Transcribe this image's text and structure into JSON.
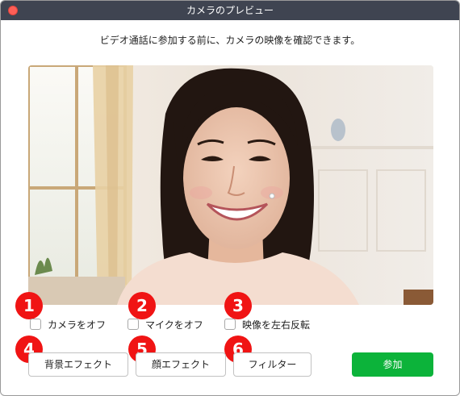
{
  "window": {
    "title": "カメラのプレビュー"
  },
  "instruction": "ビデオ通話に参加する前に、カメラの映像を確認できます。",
  "badges": [
    "1",
    "2",
    "3",
    "4",
    "5",
    "6"
  ],
  "options": {
    "camera_off": "カメラをオフ",
    "mic_off": "マイクをオフ",
    "mirror_video": "映像を左右反転"
  },
  "buttons": {
    "background_effect": "背景エフェクト",
    "face_effect": "顔エフェクト",
    "filter": "フィルター",
    "join": "参加"
  },
  "colors": {
    "titlebar": "#3f4451",
    "badge": "#f01414",
    "join_button": "#0cb33a",
    "close_button": "#fe5f57"
  }
}
